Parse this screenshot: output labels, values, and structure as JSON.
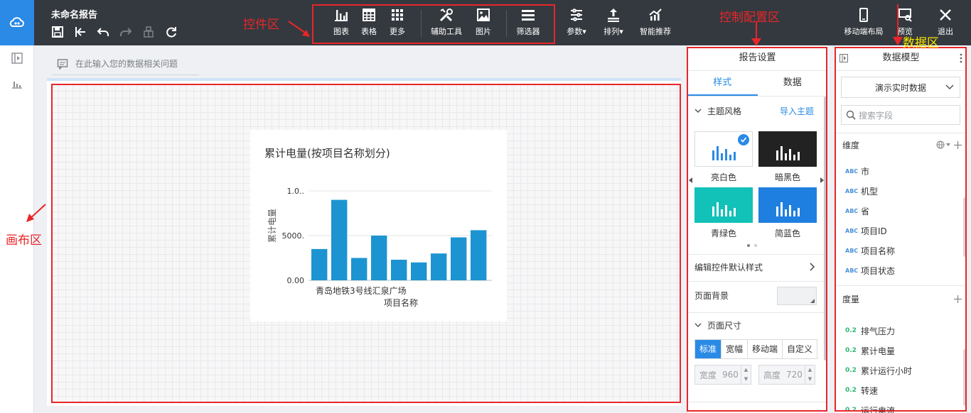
{
  "header": {
    "title": "未命名报告",
    "component_buttons": [
      {
        "label": "图表",
        "icon": "bar-chart-icon"
      },
      {
        "label": "表格",
        "icon": "table-icon"
      },
      {
        "label": "更多",
        "icon": "grid-more-icon"
      },
      {
        "label": "辅助工具",
        "icon": "tools-icon"
      },
      {
        "label": "图片",
        "icon": "image-icon"
      },
      {
        "label": "筛选器",
        "icon": "filter-list-icon"
      }
    ],
    "param_buttons": [
      {
        "label": "参数▾",
        "icon": "params-icon"
      },
      {
        "label": "排列▾",
        "icon": "arrange-icon"
      },
      {
        "label": "智能推荐",
        "icon": "smart-recommend-icon"
      }
    ],
    "right_buttons": [
      {
        "label": "移动端布局",
        "icon": "mobile-icon"
      },
      {
        "label": "预览",
        "icon": "preview-icon"
      },
      {
        "label": "退出",
        "icon": "close-icon"
      }
    ]
  },
  "canvas": {
    "ask_placeholder": "在此输入您的数据相关问题"
  },
  "chart_data": {
    "type": "bar",
    "title": "累计电量(按项目名称划分)",
    "xlabel": "项目名称",
    "ylabel": "累计电量",
    "y_tick_labels": [
      "1.0..",
      "5000.",
      "0.00"
    ],
    "x_tick_labels": [
      "青岛地铁3号线汇泉广场"
    ],
    "ylim": [
      0,
      10000
    ],
    "values": [
      3500,
      9000,
      2500,
      5000,
      2300,
      2000,
      3000,
      4800,
      5600
    ],
    "bar_color": "#1c94d2",
    "grid": true
  },
  "settings": {
    "title": "报告设置",
    "tabs": [
      "样式",
      "数据"
    ],
    "theme_section": "主题风格",
    "import_theme": "导入主题",
    "themes": [
      {
        "label": "亮白色",
        "bg": "#ffffff",
        "bar": "#2a8ae6"
      },
      {
        "label": "暗黑色",
        "bg": "#222222",
        "bar": "#ffffff"
      },
      {
        "label": "青绿色",
        "bg": "#12c1b7",
        "bar": "#ffffff"
      },
      {
        "label": "简蓝色",
        "bg": "#1f7fe0",
        "bar": "#ffffff"
      }
    ],
    "edit_default_style": "编辑控件默认样式",
    "page_background": "页面背景",
    "page_size": "页面尺寸",
    "size_options": [
      "标准",
      "宽幅",
      "移动端",
      "自定义"
    ],
    "width_label": "宽度",
    "width_value": "960",
    "height_label": "高度",
    "height_value": "720"
  },
  "data_model": {
    "title": "数据模型",
    "source": "演示实时数据",
    "search_placeholder": "搜索字段",
    "dimension_label": "维度",
    "dimensions": [
      "市",
      "机型",
      "省",
      "项目ID",
      "项目名称",
      "项目状态"
    ],
    "measure_label": "度量",
    "measures": [
      "排气压力",
      "累计电量",
      "累计运行小时",
      "转速",
      "运行电流"
    ],
    "dim_tag": "ABC",
    "measure_tag": "0.2"
  },
  "annotations": {
    "widget_area": "控件区",
    "config_area": "控制配置区",
    "data_area": "数据区",
    "canvas_area": "画布区"
  }
}
